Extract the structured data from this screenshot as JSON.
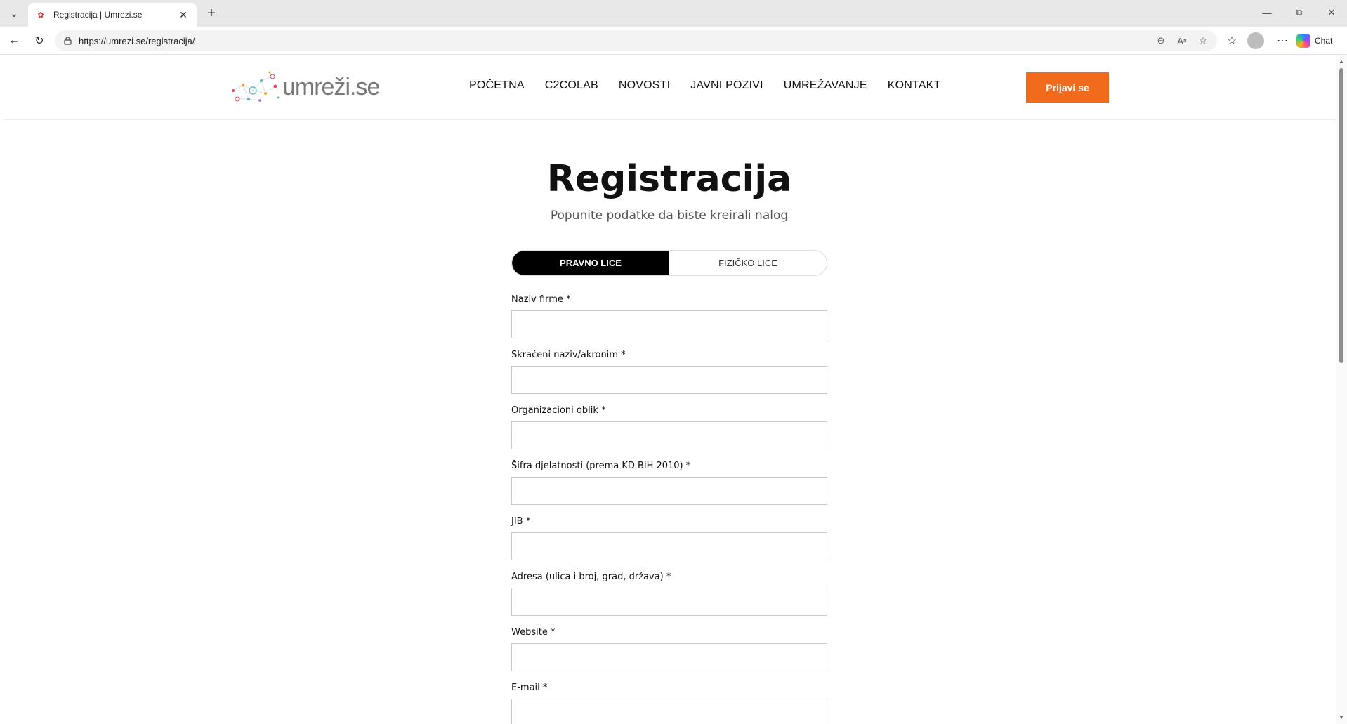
{
  "browser": {
    "tab_title": "Registracija | Umrezi.se",
    "url": "https://umrezi.se/registracija/",
    "chat_label": "Chat",
    "icons": {
      "tab_list": "chevron-down-icon",
      "close": "close-icon",
      "new_tab": "plus-icon",
      "back": "back-arrow-icon",
      "reload": "reload-icon",
      "lock": "lock-icon",
      "zoom": "zoom-out-icon",
      "read_aloud": "read-aloud-icon",
      "favorite": "star-icon",
      "favorites": "favorites-icon",
      "more": "more-icon"
    }
  },
  "site": {
    "logo_text": "umreži.se",
    "nav": [
      "POČETNA",
      "C2COLAB",
      "NOVOSTI",
      "JAVNI POZIVI",
      "UMREŽAVANJE",
      "KONTAKT"
    ],
    "login_label": "Prijavi se",
    "accent_color": "#f26a1b"
  },
  "registration": {
    "title": "Registracija",
    "subtitle": "Popunite podatke da biste kreirali nalog",
    "toggle": {
      "legal": "PRAVNO LICE",
      "natural": "FIZIČKO LICE"
    },
    "fields": [
      "Naziv firme *",
      "Skraćeni naziv/akronim *",
      "Organizacioni oblik *",
      "Šifra djelatnosti (prema KD BiH 2010) *",
      "JIB *",
      "Adresa (ulica i broj, grad, država) *",
      "Website *",
      "E-mail *"
    ]
  }
}
